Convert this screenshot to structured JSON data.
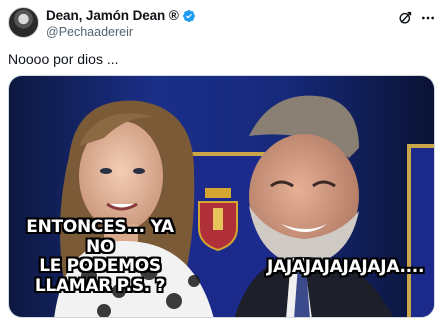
{
  "tweet": {
    "author": {
      "display_name": "Dean, Jamón Dean ®",
      "handle": "@Pechaadereir",
      "verified": true,
      "avatar_icon": "avatar-photo"
    },
    "text": "Noooo por dios ...",
    "icons": {
      "grok": "grok-icon",
      "more": "more-options-icon"
    },
    "media": {
      "caption_left": "ENTONCES... YA NO\nLE PODEMOS\nLLAMAR P.S. ?",
      "caption_right": "JAJAJAJAJAJAJA...."
    }
  },
  "colors": {
    "verified_blue": "#1d9bf0",
    "handle_gray": "#536471",
    "background": "#ffffff"
  }
}
